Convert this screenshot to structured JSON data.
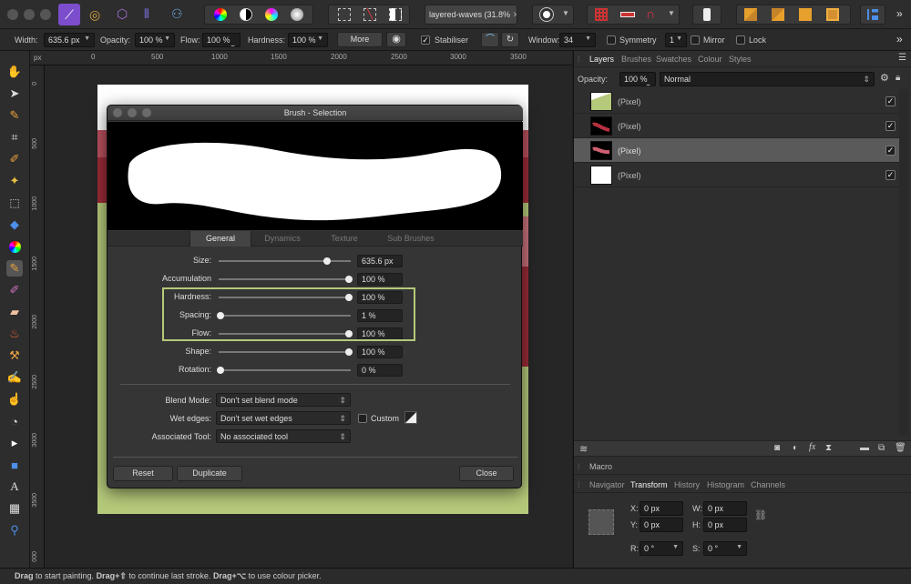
{
  "document_tab": "layered-waves (31.8%",
  "context": {
    "width_label": "Width:",
    "width_value": "635.6 px",
    "opacity_label": "Opacity:",
    "opacity_value": "100 %",
    "flow_label": "Flow:",
    "flow_value": "100 %",
    "hardness_label": "Hardness:",
    "hardness_value": "100 %",
    "more_label": "More",
    "stabiliser_label": "Stabiliser",
    "window_label": "Window:",
    "window_value": "34",
    "symmetry_label": "Symmetry",
    "symmetry_value": "1",
    "mirror_label": "Mirror",
    "lock_label": "Lock"
  },
  "ruler": {
    "unit": "px",
    "h_ticks": [
      "0",
      "500",
      "1000",
      "1500",
      "2000",
      "2500",
      "3000",
      "3500"
    ],
    "v_ticks": [
      "0",
      "500",
      "1000",
      "1500",
      "2000",
      "2500",
      "3000",
      "3500",
      "000"
    ]
  },
  "dialog": {
    "title": "Brush - Selection",
    "tabs": [
      "General",
      "Dynamics",
      "Texture",
      "Sub Brushes"
    ],
    "rows": [
      {
        "label": "Size:",
        "value": "635.6 px",
        "level": 0.83
      },
      {
        "label": "Accumulation",
        "value": "100 %",
        "level": 1
      },
      {
        "label": "Hardness:",
        "value": "100 %",
        "level": 1
      },
      {
        "label": "Spacing:",
        "value": "1 %",
        "level": 0
      },
      {
        "label": "Flow:",
        "value": "100 %",
        "level": 1
      },
      {
        "label": "Shape:",
        "value": "100 %",
        "level": 1
      },
      {
        "label": "Rotation:",
        "value": "0 %",
        "level": 0
      }
    ],
    "blend_mode_label": "Blend Mode:",
    "blend_mode_value": "Don't set blend mode",
    "wet_edges_label": "Wet edges:",
    "wet_edges_value": "Don't set wet edges",
    "custom_label": "Custom",
    "assoc_tool_label": "Associated Tool:",
    "assoc_tool_value": "No associated tool",
    "reset_label": "Reset",
    "duplicate_label": "Duplicate",
    "close_label": "Close"
  },
  "panel": {
    "tabs": [
      "Layers",
      "Brushes",
      "Swatches",
      "Colour",
      "Styles"
    ],
    "opacity_label": "Opacity:",
    "opacity_value": "100 %",
    "blend_value": "Normal",
    "layers": [
      {
        "name": "(Pixel)",
        "thumb": "green"
      },
      {
        "name": "(Pixel)",
        "thumb": "red-wave"
      },
      {
        "name": "(Pixel)",
        "thumb": "pink-wave"
      },
      {
        "name": "(Pixel)",
        "thumb": "white"
      }
    ],
    "macro_label": "Macro",
    "bottom_tabs": [
      "Navigator",
      "Transform",
      "History",
      "Histogram",
      "Channels"
    ],
    "transform": {
      "x_label": "X:",
      "x_value": "0 px",
      "w_label": "W:",
      "w_value": "0 px",
      "y_label": "Y:",
      "y_value": "0 px",
      "h_label": "H:",
      "h_value": "0 px",
      "r_label": "R:",
      "r_value": "0 °",
      "s_label": "S:",
      "s_value": "0 °"
    }
  },
  "status": {
    "drag1": "Drag",
    "text1": " to start painting. ",
    "drag2": "Drag+",
    "glyph2": "⇧",
    "text2": " to continue last stroke. ",
    "drag3": "Drag+",
    "glyph3": "⌥",
    "text3": " to use colour picker."
  },
  "colors": {
    "accent_green": "#b5c97a",
    "red_band": "#9a2b38",
    "pink_band": "#b8505e",
    "selected_layer": "#5a5a5a"
  }
}
